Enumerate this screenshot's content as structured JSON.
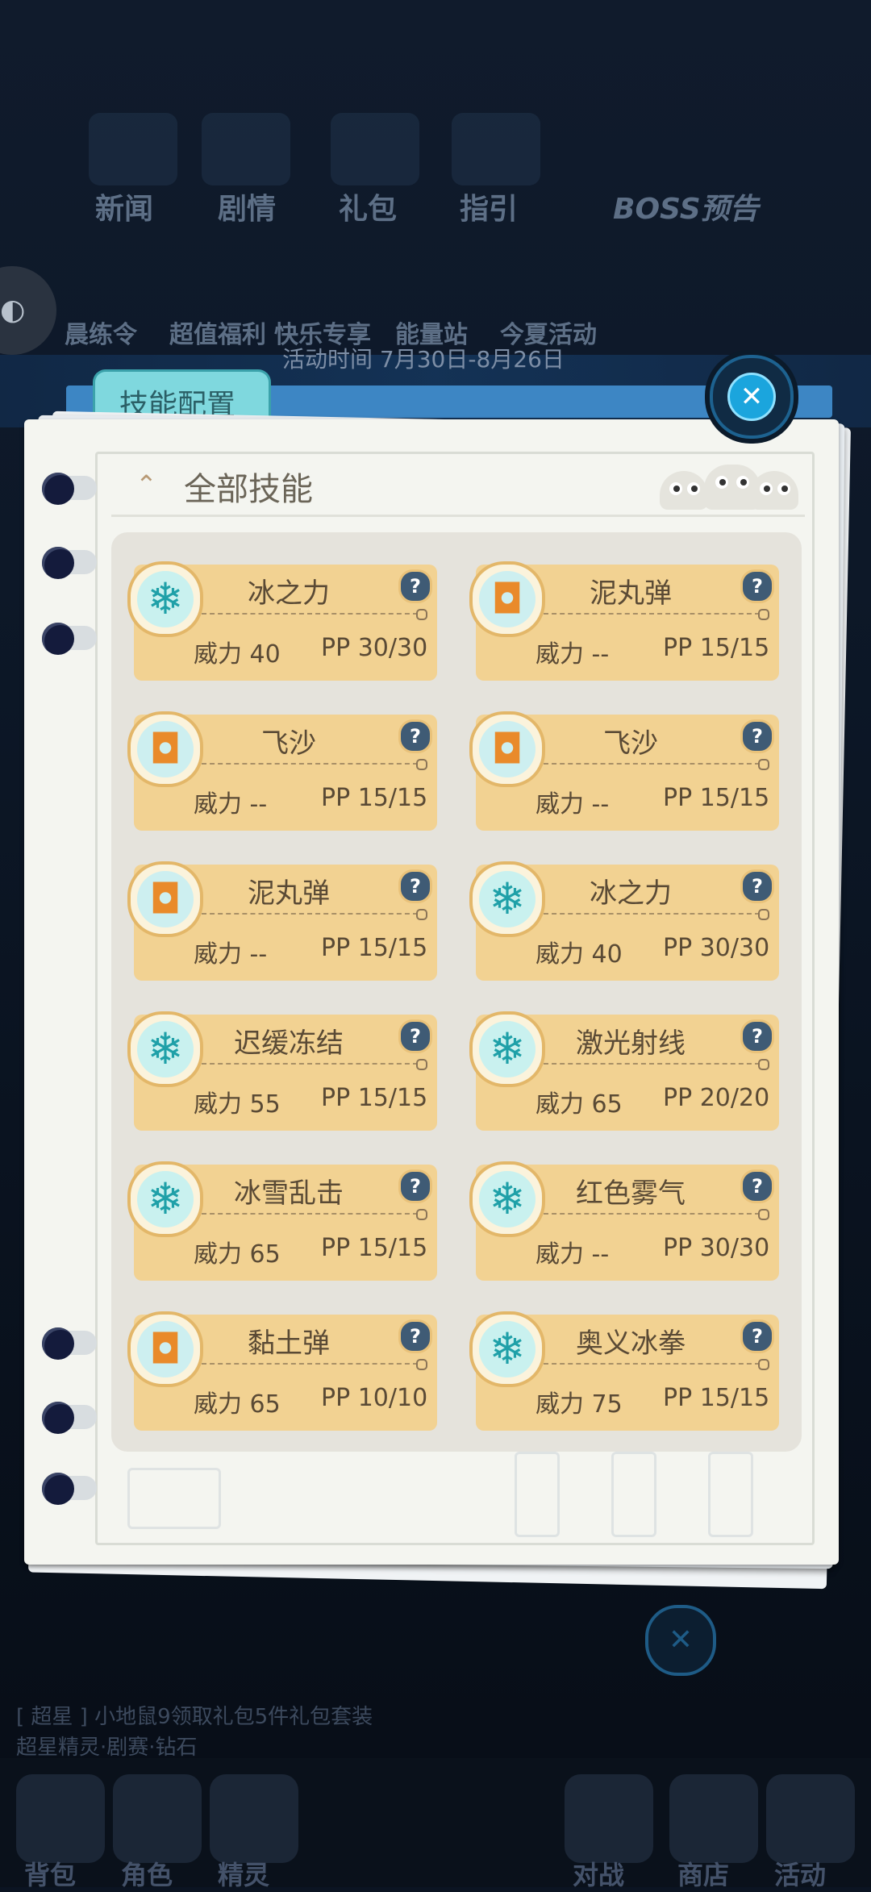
{
  "background": {
    "nav_items": [
      "新闻",
      "剧情",
      "礼包",
      "指引",
      "BOSS预告"
    ],
    "event_items": [
      "晨练令",
      "超值福利",
      "快乐专享",
      "能量站",
      "今夏活动"
    ],
    "activity_time": "活动时间 7月30日-8月26日",
    "ticker_lines": [
      "[ 超星 ] 小地鼠9领取礼包5件礼包套装",
      "超星精灵·剧赛·钻石"
    ],
    "bottom_nav": [
      "背包",
      "角色",
      "精灵",
      "对战",
      "商店",
      "活动"
    ]
  },
  "panel": {
    "tab_label": "技能配置",
    "header_title": "全部技能",
    "help_symbol": "?",
    "close_symbol": "✕"
  },
  "skills": [
    {
      "name": "冰之力",
      "power": "威力 40",
      "pp": "PP 30/30",
      "type": "ice",
      "icon": "snowflake-icon"
    },
    {
      "name": "泥丸弹",
      "power": "威力 --",
      "pp": "PP 15/15",
      "type": "ground",
      "icon": "ground-square-icon"
    },
    {
      "name": "飞沙",
      "power": "威力 --",
      "pp": "PP 15/15",
      "type": "ground",
      "icon": "ground-square-icon"
    },
    {
      "name": "飞沙",
      "power": "威力 --",
      "pp": "PP 15/15",
      "type": "ground",
      "icon": "ground-square-icon"
    },
    {
      "name": "泥丸弹",
      "power": "威力 --",
      "pp": "PP 15/15",
      "type": "ground",
      "icon": "ground-square-icon"
    },
    {
      "name": "冰之力",
      "power": "威力 40",
      "pp": "PP 30/30",
      "type": "ice",
      "icon": "snowflake-icon"
    },
    {
      "name": "迟缓冻结",
      "power": "威力 55",
      "pp": "PP 15/15",
      "type": "ice",
      "icon": "snowflake-icon"
    },
    {
      "name": "激光射线",
      "power": "威力 65",
      "pp": "PP 20/20",
      "type": "ice",
      "icon": "snowflake-icon"
    },
    {
      "name": "冰雪乱击",
      "power": "威力 65",
      "pp": "PP 15/15",
      "type": "ice",
      "icon": "snowflake-icon"
    },
    {
      "name": "红色雾气",
      "power": "威力 --",
      "pp": "PP 30/30",
      "type": "ice",
      "icon": "snowflake-icon"
    },
    {
      "name": "黏土弹",
      "power": "威力 65",
      "pp": "PP 10/10",
      "type": "ground",
      "icon": "ground-square-icon"
    },
    {
      "name": "奥义冰拳",
      "power": "威力 75",
      "pp": "PP 15/15",
      "type": "ice",
      "icon": "snowflake-icon"
    }
  ]
}
